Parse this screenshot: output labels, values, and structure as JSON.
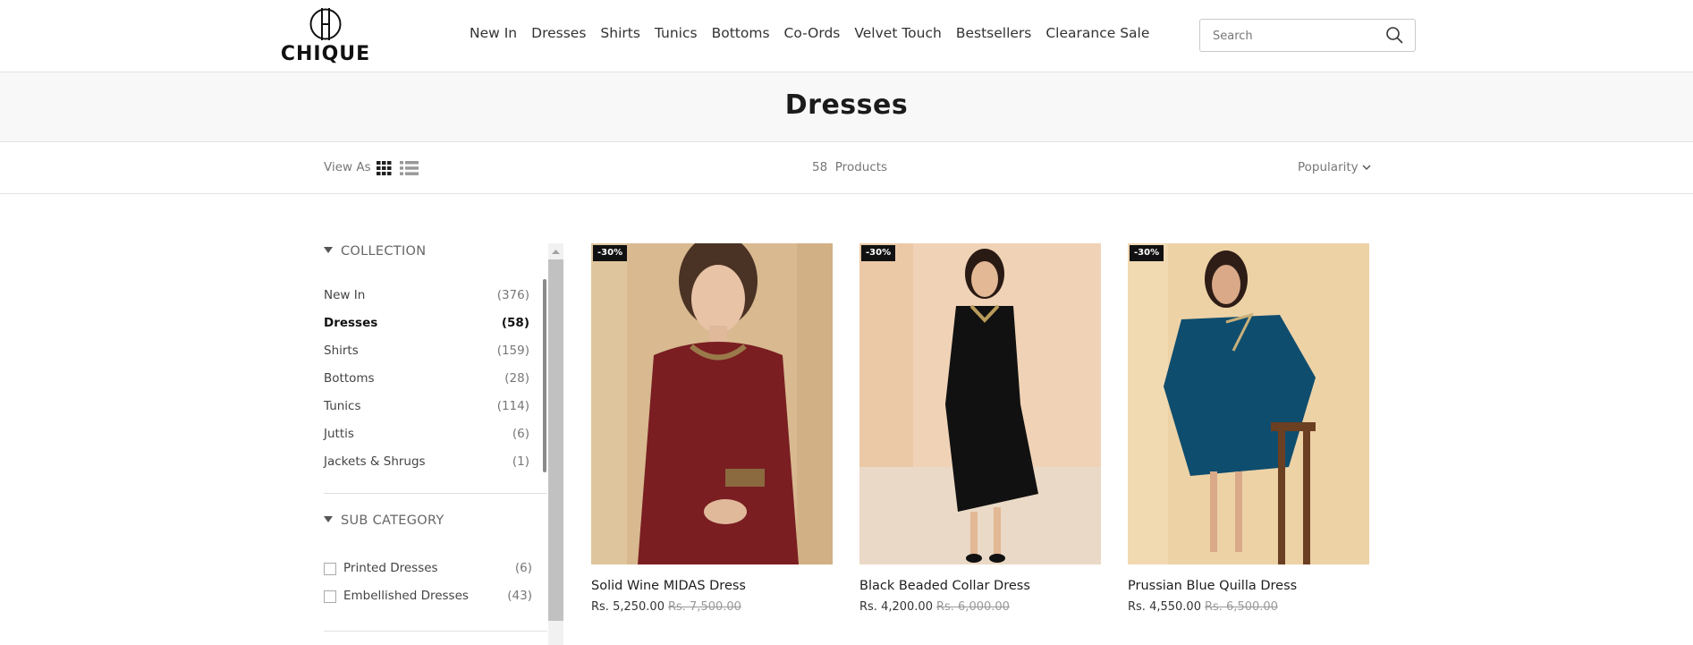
{
  "brand": {
    "name": "CHIQUE"
  },
  "nav": {
    "items": [
      "New In",
      "Dresses",
      "Shirts",
      "Tunics",
      "Bottoms",
      "Co-Ords",
      "Velvet Touch",
      "Bestsellers",
      "Clearance Sale"
    ]
  },
  "search": {
    "placeholder": "Search",
    "icon": "search-icon"
  },
  "page": {
    "title": "Dresses"
  },
  "toolbar": {
    "view_as_label": "View As",
    "count_number": "58",
    "count_label": "Products",
    "sort_label": "Popularity"
  },
  "collection": {
    "heading": "COLLECTION",
    "items": [
      {
        "label": "New In",
        "count": "(376)",
        "active": false
      },
      {
        "label": "Dresses",
        "count": "(58)",
        "active": true
      },
      {
        "label": "Shirts",
        "count": "(159)",
        "active": false
      },
      {
        "label": "Bottoms",
        "count": "(28)",
        "active": false
      },
      {
        "label": "Tunics",
        "count": "(114)",
        "active": false
      },
      {
        "label": "Juttis",
        "count": "(6)",
        "active": false
      },
      {
        "label": "Jackets & Shrugs",
        "count": "(1)",
        "active": false
      }
    ]
  },
  "sub_category": {
    "heading": "SUB CATEGORY",
    "items": [
      {
        "label": "Printed Dresses",
        "count": "(6)",
        "checked": false
      },
      {
        "label": "Embellished Dresses",
        "count": "(43)",
        "checked": false
      }
    ]
  },
  "products": [
    {
      "badge": "-30%",
      "name": "Solid Wine MIDAS Dress",
      "price": "Rs. 5,250.00",
      "old_price": "Rs. 7,500.00",
      "colors": {
        "bg": "#d8b990",
        "dress": "#7a1e22"
      }
    },
    {
      "badge": "-30%",
      "name": "Black Beaded Collar Dress",
      "price": "Rs. 4,200.00",
      "old_price": "Rs. 6,000.00",
      "colors": {
        "bg": "#f0d2b6",
        "dress": "#111111"
      }
    },
    {
      "badge": "-30%",
      "name": "Prussian Blue Quilla Dress",
      "price": "Rs. 4,550.00",
      "old_price": "Rs. 6,500.00",
      "colors": {
        "bg": "#edd2a6",
        "dress": "#0f4d6e"
      }
    }
  ]
}
